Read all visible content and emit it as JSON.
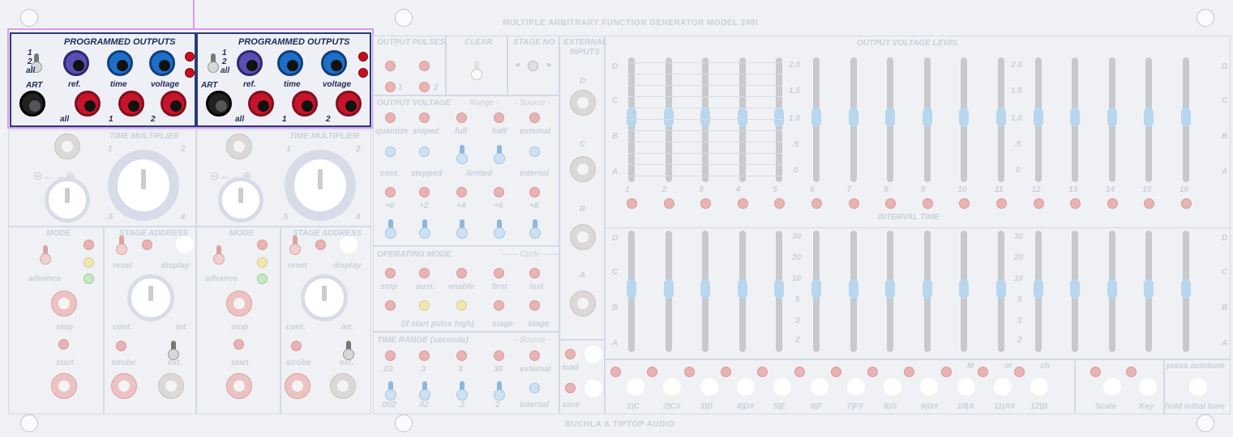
{
  "panel": {
    "title": "MULTIPLE ARBITRARY FUNCTION GENERATOR MODEL 248t",
    "footer": "BUCHLA & TIPTOP AUDIO"
  },
  "programmed_outputs": [
    {
      "title": "PROGRAMMED    OUTPUTS",
      "switch_labels": [
        "1",
        "2",
        "all"
      ],
      "art": "ART",
      "top_labels": [
        "ref.",
        "time",
        "voltage"
      ],
      "bottom_labels": [
        "all",
        "1",
        "2"
      ]
    },
    {
      "title": "PROGRAMMED    OUTPUTS",
      "switch_labels": [
        "1",
        "2",
        "all"
      ],
      "art": "ART",
      "top_labels": [
        "ref.",
        "time",
        "voltage"
      ],
      "bottom_labels": [
        "all",
        "1",
        "2"
      ]
    }
  ],
  "time_multiplier": {
    "label": "TIME MULTIPLIER",
    "tick_1": "1",
    "tick_2": "2",
    "tick_5": ".5",
    "tick_4": "4"
  },
  "mode": {
    "label": "MODE",
    "advance": "advance",
    "stop": "stop",
    "start": "start"
  },
  "stage_address": {
    "label": "STAGE ADDRESS",
    "reset": "reset",
    "display": "display",
    "cont": "cont.",
    "int": "int.",
    "strobe": "strobe",
    "ext": "ext."
  },
  "output_pulses": {
    "label": "OUTPUT PULSES",
    "p1": "1",
    "p2": "2"
  },
  "clear": {
    "label": "CLEAR"
  },
  "stage_no": {
    "label": "STAGE NO"
  },
  "external_inputs": {
    "label1": "EXTERNAL",
    "label2": "INPUTS",
    "jacks": [
      "D",
      "C",
      "B",
      "A"
    ]
  },
  "output_voltage": {
    "label": "OUTPUT VOLTAGE",
    "range": "- Range -",
    "source": "- Source -",
    "row1": [
      "quantize",
      "sloped",
      "full",
      "half",
      "external"
    ],
    "row2": [
      "cont.",
      "stepped",
      "limited",
      "internal"
    ],
    "row3": [
      "+0",
      "+2",
      "+4",
      "+6",
      "+8"
    ]
  },
  "operating_mode": {
    "label": "OPERATING MODE",
    "cycle": "Cycle",
    "row1": [
      "stop",
      "sust.",
      "enable",
      "first",
      "last"
    ],
    "row2": [
      "(if start pulse high)",
      "stage",
      "stage"
    ]
  },
  "time_range": {
    "label": "TIME RANGE (seconds)",
    "source": "- Source -",
    "row1": [
      ".03",
      ".3",
      "3",
      "30",
      "external"
    ],
    "row2": [
      ".002",
      ".02",
      ".2",
      "2",
      "internal"
    ]
  },
  "load_save": {
    "load": "load",
    "save": "save"
  },
  "output_voltage_level": {
    "label": "OUTPUT VOLTAGE LEVEL",
    "letters": [
      "D",
      "C",
      "B",
      "A"
    ],
    "scale": [
      "2.0",
      "1.5",
      "1.0",
      ".5",
      "0"
    ],
    "stage_numbers": [
      "1",
      "2",
      "3",
      "4",
      "5",
      "6",
      "7",
      "8",
      "9",
      "10",
      "11",
      "12",
      "13",
      "14",
      "15",
      "16"
    ]
  },
  "interval_time": {
    "label": "INTERVAL TIME",
    "scale": [
      "30",
      "20",
      "10",
      "5",
      "3",
      "2"
    ]
  },
  "keyboard": {
    "notes": [
      "1|C",
      "2|C#",
      "3|D",
      "4|D#",
      "5|E",
      "6|F",
      "7|F#",
      "8|G",
      "9|G#",
      "10|A",
      "11|A#",
      "12|B"
    ],
    "m_upper": "M",
    "m_lower": "m",
    "ch": "ch",
    "scale": "Scale",
    "key": "Key",
    "press_autotune": "press autotune",
    "hold_initial_tune": "hold initial tune"
  },
  "colors": {
    "panel": "#f0f1f4",
    "active_outline": "#2a3b78",
    "selection": "#d79cf0",
    "led_red": "#c90d1f",
    "jack_blue": "#1e6fc7",
    "jack_red": "#c6142a",
    "jack_violet": "#5a4fb0"
  }
}
